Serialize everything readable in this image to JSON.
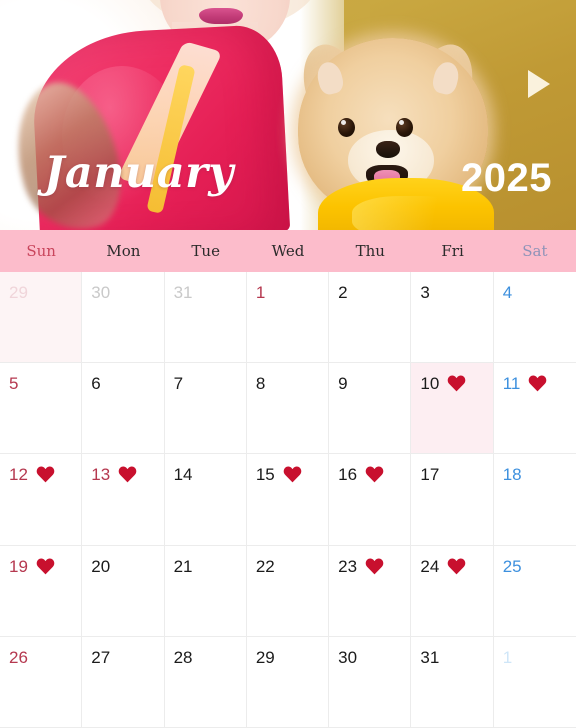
{
  "hero": {
    "month_label": "January",
    "year_label": "2025",
    "next_icon": "play-triangle-icon",
    "photo_alt": "woman in pink kimono holding a pomeranian dog in a yellow outfit",
    "colors": {
      "gold_backdrop": "#c4a03c",
      "kimono_pink": "#ee2f63",
      "dog_coat_yellow": "#fcc300",
      "title_text": "#ffffff"
    }
  },
  "weekdays": [
    {
      "label": "Sun",
      "kind": "sun"
    },
    {
      "label": "Mon",
      "kind": "weekday"
    },
    {
      "label": "Tue",
      "kind": "weekday"
    },
    {
      "label": "Wed",
      "kind": "weekday"
    },
    {
      "label": "Thu",
      "kind": "weekday"
    },
    {
      "label": "Fri",
      "kind": "weekday"
    },
    {
      "label": "Sat",
      "kind": "sat"
    }
  ],
  "theme": {
    "header_band": "#fcbccb",
    "grid_line": "#ececec",
    "sunday_red": "#b5384f",
    "saturday_blue": "#3d90de",
    "heart_red": "#c8102e",
    "highlight_cell": "#fdeef2"
  },
  "weeks": [
    [
      {
        "day": "29",
        "kind": "sun",
        "outside": true,
        "heart": false,
        "tint": "sun"
      },
      {
        "day": "30",
        "kind": "weekday",
        "outside": true,
        "heart": false,
        "tint": ""
      },
      {
        "day": "31",
        "kind": "weekday",
        "outside": true,
        "heart": false,
        "tint": ""
      },
      {
        "day": "1",
        "kind": "holiday",
        "outside": false,
        "heart": false,
        "tint": ""
      },
      {
        "day": "2",
        "kind": "weekday",
        "outside": false,
        "heart": false,
        "tint": ""
      },
      {
        "day": "3",
        "kind": "weekday",
        "outside": false,
        "heart": false,
        "tint": ""
      },
      {
        "day": "4",
        "kind": "sat",
        "outside": false,
        "heart": false,
        "tint": ""
      }
    ],
    [
      {
        "day": "5",
        "kind": "sun",
        "outside": false,
        "heart": false,
        "tint": ""
      },
      {
        "day": "6",
        "kind": "weekday",
        "outside": false,
        "heart": false,
        "tint": ""
      },
      {
        "day": "7",
        "kind": "weekday",
        "outside": false,
        "heart": false,
        "tint": ""
      },
      {
        "day": "8",
        "kind": "weekday",
        "outside": false,
        "heart": false,
        "tint": ""
      },
      {
        "day": "9",
        "kind": "weekday",
        "outside": false,
        "heart": false,
        "tint": ""
      },
      {
        "day": "10",
        "kind": "weekday",
        "outside": false,
        "heart": true,
        "tint": "hl"
      },
      {
        "day": "11",
        "kind": "sat",
        "outside": false,
        "heart": true,
        "tint": ""
      }
    ],
    [
      {
        "day": "12",
        "kind": "sun",
        "outside": false,
        "heart": true,
        "tint": ""
      },
      {
        "day": "13",
        "kind": "holiday",
        "outside": false,
        "heart": true,
        "tint": ""
      },
      {
        "day": "14",
        "kind": "weekday",
        "outside": false,
        "heart": false,
        "tint": ""
      },
      {
        "day": "15",
        "kind": "weekday",
        "outside": false,
        "heart": true,
        "tint": ""
      },
      {
        "day": "16",
        "kind": "weekday",
        "outside": false,
        "heart": true,
        "tint": ""
      },
      {
        "day": "17",
        "kind": "weekday",
        "outside": false,
        "heart": false,
        "tint": ""
      },
      {
        "day": "18",
        "kind": "sat",
        "outside": false,
        "heart": false,
        "tint": ""
      }
    ],
    [
      {
        "day": "19",
        "kind": "sun",
        "outside": false,
        "heart": true,
        "tint": ""
      },
      {
        "day": "20",
        "kind": "weekday",
        "outside": false,
        "heart": false,
        "tint": ""
      },
      {
        "day": "21",
        "kind": "weekday",
        "outside": false,
        "heart": false,
        "tint": ""
      },
      {
        "day": "22",
        "kind": "weekday",
        "outside": false,
        "heart": false,
        "tint": ""
      },
      {
        "day": "23",
        "kind": "weekday",
        "outside": false,
        "heart": true,
        "tint": ""
      },
      {
        "day": "24",
        "kind": "weekday",
        "outside": false,
        "heart": true,
        "tint": ""
      },
      {
        "day": "25",
        "kind": "sat",
        "outside": false,
        "heart": false,
        "tint": ""
      }
    ],
    [
      {
        "day": "26",
        "kind": "sun",
        "outside": false,
        "heart": false,
        "tint": ""
      },
      {
        "day": "27",
        "kind": "weekday",
        "outside": false,
        "heart": false,
        "tint": ""
      },
      {
        "day": "28",
        "kind": "weekday",
        "outside": false,
        "heart": false,
        "tint": ""
      },
      {
        "day": "29",
        "kind": "weekday",
        "outside": false,
        "heart": false,
        "tint": ""
      },
      {
        "day": "30",
        "kind": "weekday",
        "outside": false,
        "heart": false,
        "tint": ""
      },
      {
        "day": "31",
        "kind": "weekday",
        "outside": false,
        "heart": false,
        "tint": ""
      },
      {
        "day": "1",
        "kind": "sat",
        "outside": true,
        "heart": false,
        "tint": ""
      }
    ]
  ]
}
